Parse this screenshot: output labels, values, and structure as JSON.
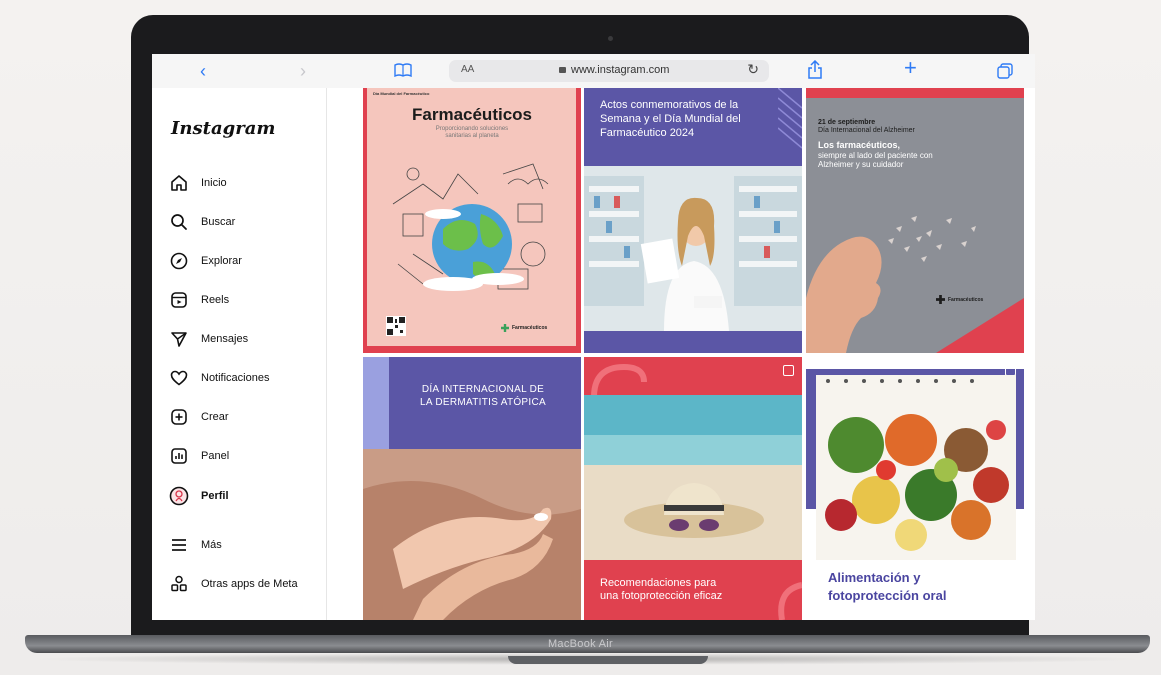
{
  "browser": {
    "url": "www.instagram.com",
    "text_size_label": "AA",
    "icons": [
      "chevron-left-icon",
      "chevron-right-icon",
      "book-icon",
      "lock-icon",
      "reload-icon",
      "share-icon",
      "plus-icon",
      "tabs-icon"
    ]
  },
  "sidebar": {
    "logo": "Instagram",
    "items": [
      {
        "label": "Inicio",
        "icon": "home-icon",
        "active": false
      },
      {
        "label": "Buscar",
        "icon": "search-icon",
        "active": false
      },
      {
        "label": "Explorar",
        "icon": "compass-icon",
        "active": false
      },
      {
        "label": "Reels",
        "icon": "reels-icon",
        "active": false
      },
      {
        "label": "Mensajes",
        "icon": "send-icon",
        "active": false
      },
      {
        "label": "Notificaciones",
        "icon": "heart-icon",
        "active": false
      },
      {
        "label": "Crear",
        "icon": "plus-square-icon",
        "active": false
      },
      {
        "label": "Panel",
        "icon": "chart-icon",
        "active": false
      },
      {
        "label": "Perfil",
        "icon": "avatar-icon",
        "active": true
      },
      {
        "label": "Más",
        "icon": "menu-icon",
        "active": false
      },
      {
        "label": "Otras apps de Meta",
        "icon": "meta-apps-icon",
        "active": false
      }
    ]
  },
  "posts": [
    {
      "kicker": "Día Mundial del Farmacéutico",
      "title": "Farmacéuticos",
      "subtitle": "Proporcionando soluciones sanitarias al planeta",
      "footer": "Farmacéuticos",
      "colors": {
        "bg": "#f5c6bd",
        "border": "#e0414f"
      }
    },
    {
      "title": "Actos conmemorativos de la Semana y el Día Mundial del Farmacéutico 2024",
      "colors": {
        "bg": "#5b56a6",
        "accent": "#e0414f"
      }
    },
    {
      "date": "21 de septiembre",
      "subtitle": "Día Internacional del Alzheimer",
      "headline": "Los farmacéuticos,",
      "body": "siempre al lado del paciente con Alzheimer y su cuidador",
      "footer": "Farmacéuticos",
      "colors": {
        "bg": "#8c8f96",
        "accent": "#e0414f"
      }
    },
    {
      "title": "DÍA INTERNACIONAL DE LA DERMATITIS ATÓPICA",
      "colors": {
        "bg": "#5b56a6",
        "accent": "#9aa0e0"
      }
    },
    {
      "title": "Recomendaciones para una fotoprotección eficaz",
      "colors": {
        "bg": "#e0414f",
        "sea": "#5cb6c8"
      }
    },
    {
      "title": "Alimentación y fotoprotección oral",
      "colors": {
        "bg": "#5b56a6",
        "text": "#4a45a0"
      }
    }
  ],
  "device": {
    "label": "MacBook Air"
  }
}
